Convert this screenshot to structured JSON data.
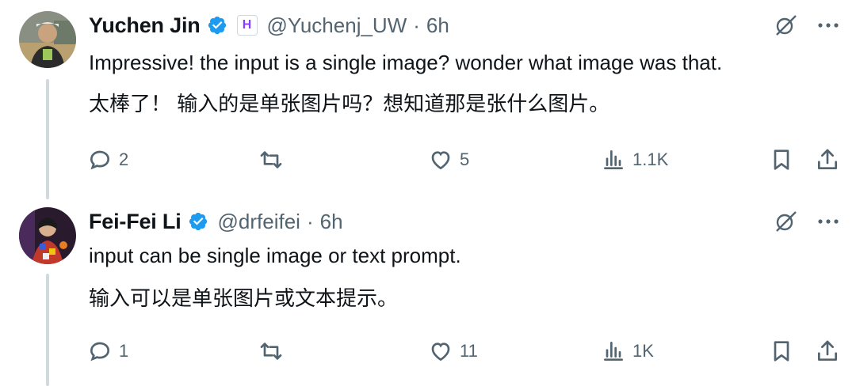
{
  "tweets": [
    {
      "name": "Yuchen Jin",
      "affiliate_badge": "H",
      "handle": "@Yuchenj_UW",
      "separator": "·",
      "time": "6h",
      "text_en": "Impressive! the input is a single image? wonder what image was that.",
      "text_zh": "太棒了！ 输入的是单张图片吗？想知道那是张什么图片。",
      "replies": "2",
      "likes": "5",
      "views": "1.1K"
    },
    {
      "name": "Fei-Fei Li",
      "handle": "@drfeifei",
      "separator": "·",
      "time": "6h",
      "text_en": "input can be single image or text prompt.",
      "text_zh": "输入可以是单张图片或文本提示。",
      "replies": "1",
      "likes": "11",
      "views": "1K"
    }
  ],
  "colors": {
    "text": "#0f1419",
    "secondary": "#536471",
    "verified": "#1d9bf0",
    "thread_line": "#cfd9de"
  },
  "icons": [
    "reply-icon",
    "retweet-icon",
    "like-icon",
    "views-icon",
    "bookmark-icon",
    "share-icon",
    "grok-icon",
    "more-icon",
    "verified-icon"
  ]
}
